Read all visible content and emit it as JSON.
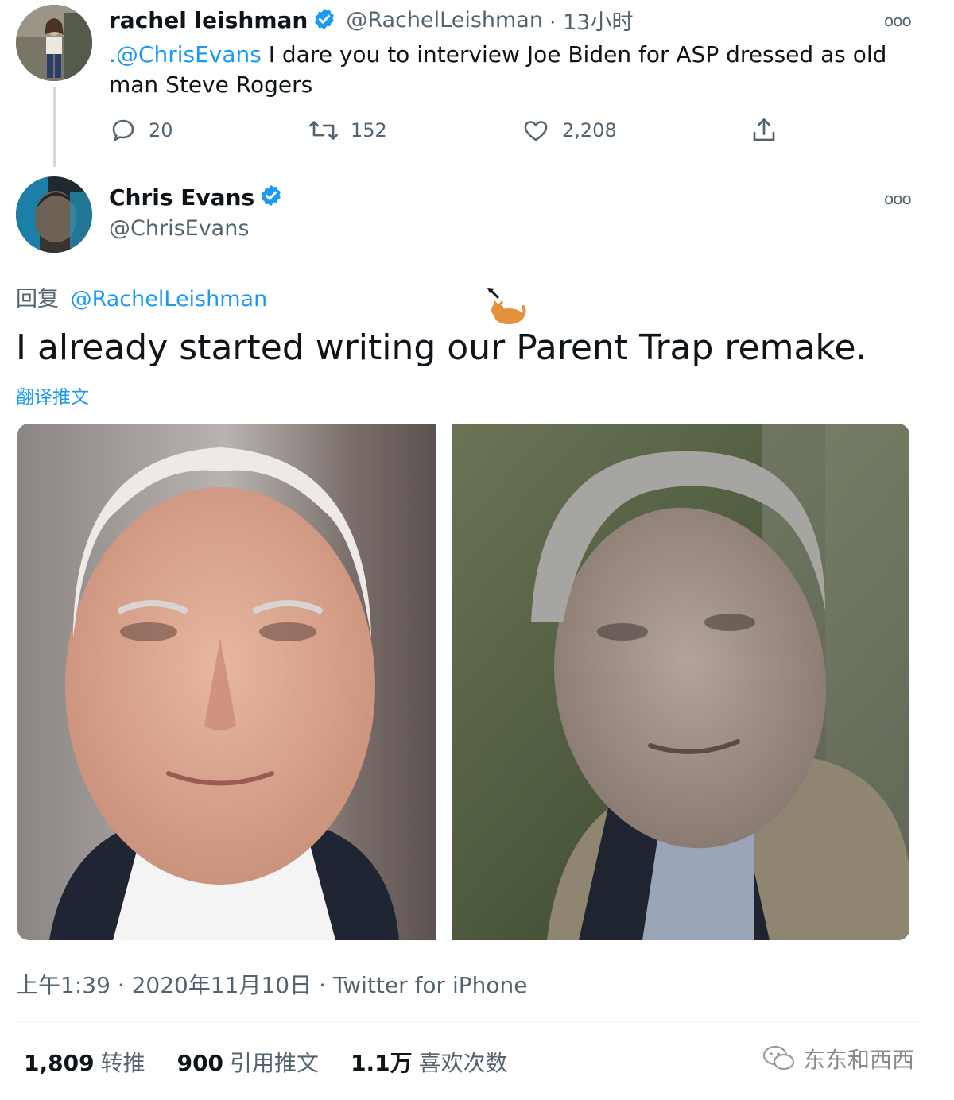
{
  "parent_tweet": {
    "author_name": "rachel leishman",
    "author_handle": "@RachelLeishman",
    "time": "· 13小时",
    "mention": ".@ChrisEvans",
    "text": " I dare you to interview Joe Biden for ASP dressed as old man Steve Rogers",
    "actions": {
      "reply_count": "20",
      "retweet_count": "152",
      "like_count": "2,208"
    }
  },
  "main_tweet": {
    "author_name": "Chris Evans",
    "author_handle": "@ChrisEvans",
    "reply_label": "回复",
    "reply_to": "@RachelLeishman",
    "text": "I already started writing our Parent Trap remake.",
    "translate_label": "翻译推文",
    "timestamp": "上午1:39 · 2020年11月10日 · Twitter for iPhone",
    "stats": [
      {
        "value": "1,809",
        "label": "转推"
      },
      {
        "value": "900",
        "label": "引用推文"
      },
      {
        "value": "1.1万",
        "label": "喜欢次数"
      }
    ]
  },
  "watermark": "东东和西西",
  "colors": {
    "accent": "#1d9bf0",
    "muted": "#536471",
    "text": "#0f1419"
  },
  "icons": [
    "verified-badge-icon",
    "more-icon",
    "reply-icon",
    "retweet-icon",
    "like-icon",
    "share-icon",
    "wechat-icon",
    "cat-sticker-icon"
  ]
}
